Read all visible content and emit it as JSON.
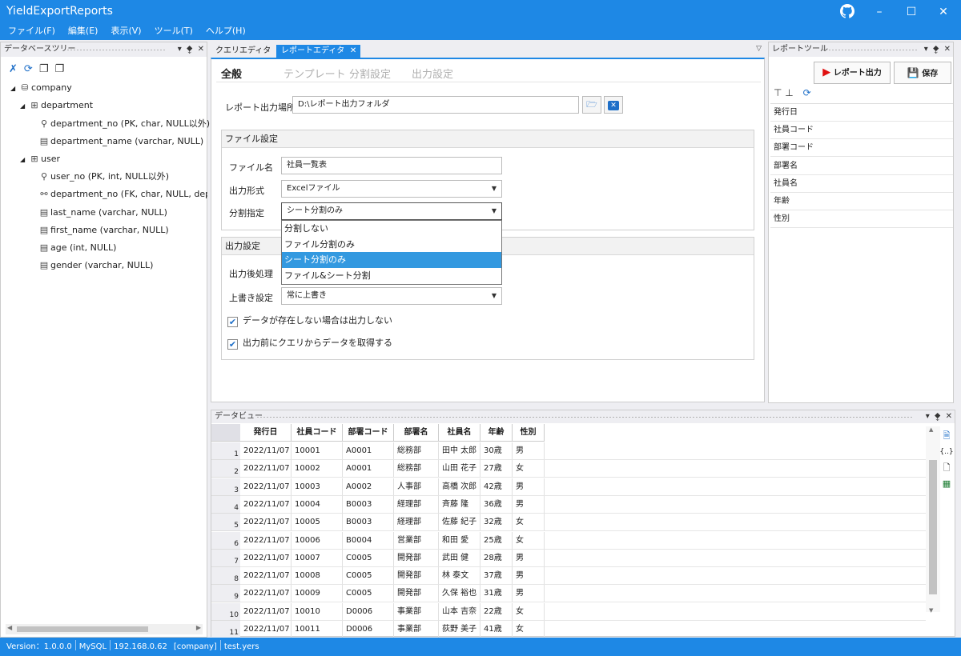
{
  "app": {
    "title": "YieldExportReports"
  },
  "menu": [
    "ファイル(F)",
    "編集(E)",
    "表示(V)",
    "ツール(T)",
    "ヘルプ(H)"
  ],
  "db_tree": {
    "title": "データベースツリー",
    "items": [
      {
        "label": "company",
        "icon": "database-icon",
        "level": 0
      },
      {
        "label": "department",
        "icon": "table-icon",
        "level": 1
      },
      {
        "label": "department_no (PK, char, NULL以外)",
        "icon": "key-icon",
        "level": 2
      },
      {
        "label": "department_name (varchar, NULL)",
        "icon": "column-icon",
        "level": 2
      },
      {
        "label": "user",
        "icon": "table-icon",
        "level": 1
      },
      {
        "label": "user_no (PK, int, NULL以外)",
        "icon": "key-icon",
        "level": 2
      },
      {
        "label": "department_no (FK, char, NULL, departme",
        "icon": "foreign-key-icon",
        "level": 2
      },
      {
        "label": "last_name (varchar, NULL)",
        "icon": "column-icon",
        "level": 2
      },
      {
        "label": "first_name (varchar, NULL)",
        "icon": "column-icon",
        "level": 2
      },
      {
        "label": "age (int, NULL)",
        "icon": "column-icon",
        "level": 2
      },
      {
        "label": "gender (varchar, NULL)",
        "icon": "column-icon",
        "level": 2
      }
    ]
  },
  "doc_tabs": [
    {
      "label": "クエリエディタ",
      "active": false
    },
    {
      "label": "レポートエディタ",
      "active": true
    }
  ],
  "editor": {
    "subtabs": [
      "全般",
      "テンプレート",
      "分割設定",
      "出力設定"
    ],
    "output_location_label": "レポート出力場所",
    "output_location_value": "D:\\レポート出力フォルダ",
    "file_group": {
      "title": "ファイル設定",
      "filename_label": "ファイル名",
      "filename_value": "社員一覧表",
      "format_label": "出力形式",
      "format_value": "Excelファイル",
      "split_label": "分割指定",
      "split_value": "シート分割のみ"
    },
    "split_options": [
      "分割しない",
      "ファイル分割のみ",
      "シート分割のみ",
      "ファイル&シート分割"
    ],
    "output_group": {
      "title": "出力設定",
      "post_label": "出力後処理",
      "overwrite_label": "上書き設定",
      "overwrite_value": "常に上書き",
      "check1": "データが存在しない場合は出力しない",
      "check2": "出力前にクエリからデータを取得する"
    }
  },
  "report_tool": {
    "title": "レポートツール",
    "output_button": "レポート出力",
    "save_button": "保存",
    "fields": [
      "発行日",
      "社員コード",
      "部署コード",
      "部署名",
      "社員名",
      "年齢",
      "性別"
    ]
  },
  "data_view": {
    "title": "データビュー",
    "columns": [
      "発行日",
      "社員コード",
      "部署コード",
      "部署名",
      "社員名",
      "年齢",
      "性別"
    ],
    "rows": [
      [
        "1",
        "2022/11/07",
        "10001",
        "A0001",
        "総務部",
        "田中 太郎",
        "30歳",
        "男"
      ],
      [
        "2",
        "2022/11/07",
        "10002",
        "A0001",
        "総務部",
        "山田 花子",
        "27歳",
        "女"
      ],
      [
        "3",
        "2022/11/07",
        "10003",
        "A0002",
        "人事部",
        "高橋 次郎",
        "42歳",
        "男"
      ],
      [
        "4",
        "2022/11/07",
        "10004",
        "B0003",
        "経理部",
        "斉藤 隆",
        "36歳",
        "男"
      ],
      [
        "5",
        "2022/11/07",
        "10005",
        "B0003",
        "経理部",
        "佐藤 紀子",
        "32歳",
        "女"
      ],
      [
        "6",
        "2022/11/07",
        "10006",
        "B0004",
        "営業部",
        "和田 愛",
        "25歳",
        "女"
      ],
      [
        "7",
        "2022/11/07",
        "10007",
        "C0005",
        "開発部",
        "武田 健",
        "28歳",
        "男"
      ],
      [
        "8",
        "2022/11/07",
        "10008",
        "C0005",
        "開発部",
        "林 泰文",
        "37歳",
        "男"
      ],
      [
        "9",
        "2022/11/07",
        "10009",
        "C0005",
        "開発部",
        "久保 裕也",
        "31歳",
        "男"
      ],
      [
        "10",
        "2022/11/07",
        "10010",
        "D0006",
        "事業部",
        "山本 吉奈",
        "22歳",
        "女"
      ],
      [
        "11",
        "2022/11/07",
        "10011",
        "D0006",
        "事業部",
        "荻野 美子",
        "41歳",
        "女"
      ]
    ]
  },
  "status": {
    "version": "Version：1.0.0.0",
    "db": "MySQL",
    "host": "192.168.0.62",
    "schema": "[company]",
    "file": "test.yers"
  }
}
